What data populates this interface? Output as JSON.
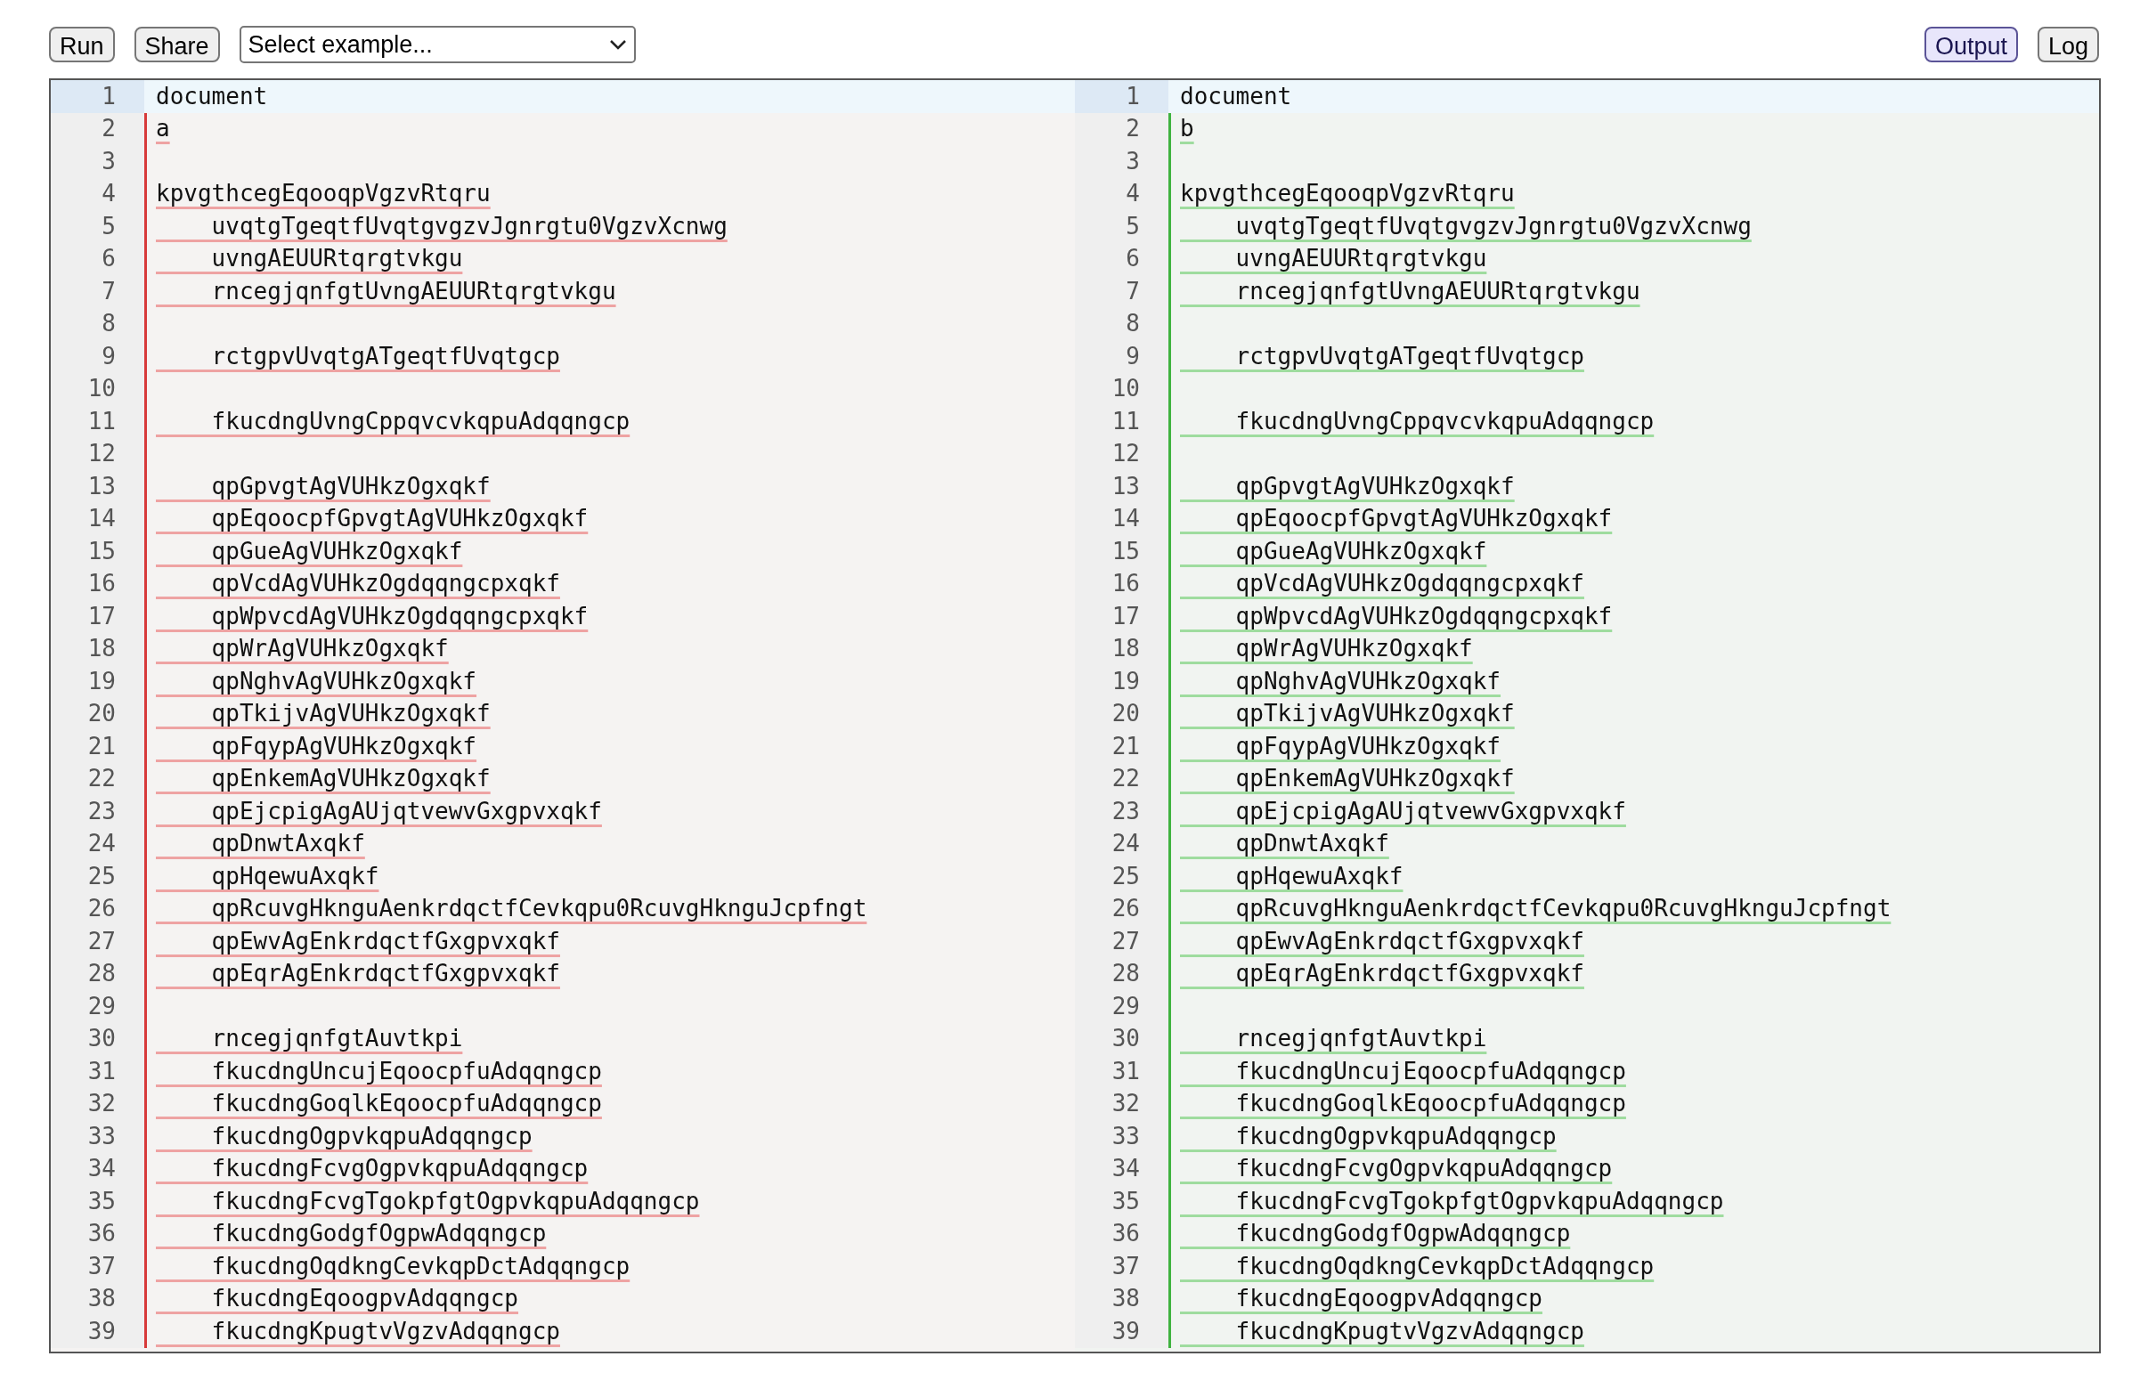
{
  "toolbar": {
    "left_buttons": [
      "Run",
      "Share"
    ],
    "example_select": {
      "value": "Select example..."
    },
    "view_tabs": [
      {
        "label": "Output",
        "selected": true
      },
      {
        "label": "Log",
        "selected": false
      }
    ]
  },
  "panes": [
    {
      "kind": "deleted",
      "lines": [
        {
          "number": "1",
          "text": "document",
          "active": true,
          "changed": false
        },
        {
          "number": "2",
          "text": "a",
          "active": false,
          "changed": true
        },
        {
          "number": "3",
          "active": false,
          "changed": true
        },
        {
          "number": "4",
          "text": "kpvgthcegEqooqpVgzvRtqru",
          "active": false,
          "changed": true
        },
        {
          "number": "5",
          "text": "    uvqtgTgeqtfUvqtgvgzvJgnrgtu0VgzvXcnwg",
          "active": false,
          "changed": true
        },
        {
          "number": "6",
          "text": "    uvngAEUURtqrgtvkgu",
          "active": false,
          "changed": true
        },
        {
          "number": "7",
          "text": "    rncegjqnfgtUvngAEUURtqrgtvkgu",
          "active": false,
          "changed": true
        },
        {
          "number": "8",
          "active": false,
          "changed": true
        },
        {
          "number": "9",
          "text": "    rctgpvUvqtgATgeqtfUvqtgcp",
          "active": false,
          "changed": true
        },
        {
          "number": "10",
          "active": false,
          "changed": true
        },
        {
          "number": "11",
          "text": "    fkucdngUvngCppqvcvkqpuAdqqngcp",
          "active": false,
          "changed": true
        },
        {
          "number": "12",
          "active": false,
          "changed": true
        },
        {
          "number": "13",
          "text": "    qpGpvgtAgVUHkzOgxqkf",
          "active": false,
          "changed": true
        },
        {
          "number": "14",
          "text": "    qpEqoocpfGpvgtAgVUHkzOgxqkf",
          "active": false,
          "changed": true
        },
        {
          "number": "15",
          "text": "    qpGueAgVUHkzOgxqkf",
          "active": false,
          "changed": true
        },
        {
          "number": "16",
          "text": "    qpVcdAgVUHkzOgdqqngcpxqkf",
          "active": false,
          "changed": true
        },
        {
          "number": "17",
          "text": "    qpWpvcdAgVUHkzOgdqqngcpxqkf",
          "active": false,
          "changed": true
        },
        {
          "number": "18",
          "text": "    qpWrAgVUHkzOgxqkf",
          "active": false,
          "changed": true
        },
        {
          "number": "19",
          "text": "    qpNghvAgVUHkzOgxqkf",
          "active": false,
          "changed": true
        },
        {
          "number": "20",
          "text": "    qpTkijvAgVUHkzOgxqkf",
          "active": false,
          "changed": true
        },
        {
          "number": "21",
          "text": "    qpFqypAgVUHkzOgxqkf",
          "active": false,
          "changed": true
        },
        {
          "number": "22",
          "text": "    qpEnkemAgVUHkzOgxqkf",
          "active": false,
          "changed": true
        },
        {
          "number": "23",
          "text": "    qpEjcpigAgAUjqtvewvGxgpvxqkf",
          "active": false,
          "changed": true
        },
        {
          "number": "24",
          "text": "    qpDnwtAxqkf",
          "active": false,
          "changed": true
        },
        {
          "number": "25",
          "text": "    qpHqewuAxqkf",
          "active": false,
          "changed": true
        },
        {
          "number": "26",
          "text": "    qpRcuvgHknguAenkrdqctfCevkqpu0RcuvgHknguJcpfngt",
          "active": false,
          "changed": true
        },
        {
          "number": "27",
          "text": "    qpEwvAgEnkrdqctfGxgpvxqkf",
          "active": false,
          "changed": true
        },
        {
          "number": "28",
          "text": "    qpEqrAgEnkrdqctfGxgpvxqkf",
          "active": false,
          "changed": true
        },
        {
          "number": "29",
          "active": false,
          "changed": true
        },
        {
          "number": "30",
          "text": "    rncegjqnfgtAuvtkpi",
          "active": false,
          "changed": true
        },
        {
          "number": "31",
          "text": "    fkucdngUncujEqoocpfuAdqqngcp",
          "active": false,
          "changed": true
        },
        {
          "number": "32",
          "text": "    fkucdngGoqlkEqoocpfuAdqqngcp",
          "active": false,
          "changed": true
        },
        {
          "number": "33",
          "text": "    fkucdngOgpvkqpuAdqqngcp",
          "active": false,
          "changed": true
        },
        {
          "number": "34",
          "text": "    fkucdngFcvgOgpvkqpuAdqqngcp",
          "active": false,
          "changed": true
        },
        {
          "number": "35",
          "text": "    fkucdngFcvgTgokpfgtOgpvkqpuAdqqngcp",
          "active": false,
          "changed": true
        },
        {
          "number": "36",
          "text": "    fkucdngGodgfOgpwAdqqngcp",
          "active": false,
          "changed": true
        },
        {
          "number": "37",
          "text": "    fkucdngOqdkngCevkqpDctAdqqngcp",
          "active": false,
          "changed": true
        },
        {
          "number": "38",
          "text": "    fkucdngEqoogpvAdqqngcp",
          "active": false,
          "changed": true
        },
        {
          "number": "39",
          "text": "    fkucdngKpugtvVgzvAdqqngcp",
          "active": false,
          "changed": true
        }
      ]
    },
    {
      "kind": "inserted",
      "lines": [
        {
          "number": "1",
          "text": "document",
          "active": true,
          "changed": false
        },
        {
          "number": "2",
          "text": "b",
          "active": false,
          "changed": true
        },
        {
          "number": "3",
          "active": false,
          "changed": true
        },
        {
          "number": "4",
          "text": "kpvgthcegEqooqpVgzvRtqru",
          "active": false,
          "changed": true
        },
        {
          "number": "5",
          "text": "    uvqtgTgeqtfUvqtgvgzvJgnrgtu0VgzvXcnwg",
          "active": false,
          "changed": true
        },
        {
          "number": "6",
          "text": "    uvngAEUURtqrgtvkgu",
          "active": false,
          "changed": true
        },
        {
          "number": "7",
          "text": "    rncegjqnfgtUvngAEUURtqrgtvkgu",
          "active": false,
          "changed": true
        },
        {
          "number": "8",
          "active": false,
          "changed": true
        },
        {
          "number": "9",
          "text": "    rctgpvUvqtgATgeqtfUvqtgcp",
          "active": false,
          "changed": true
        },
        {
          "number": "10",
          "active": false,
          "changed": true
        },
        {
          "number": "11",
          "text": "    fkucdngUvngCppqvcvkqpuAdqqngcp",
          "active": false,
          "changed": true
        },
        {
          "number": "12",
          "active": false,
          "changed": true
        },
        {
          "number": "13",
          "text": "    qpGpvgtAgVUHkzOgxqkf",
          "active": false,
          "changed": true
        },
        {
          "number": "14",
          "text": "    qpEqoocpfGpvgtAgVUHkzOgxqkf",
          "active": false,
          "changed": true
        },
        {
          "number": "15",
          "text": "    qpGueAgVUHkzOgxqkf",
          "active": false,
          "changed": true
        },
        {
          "number": "16",
          "text": "    qpVcdAgVUHkzOgdqqngcpxqkf",
          "active": false,
          "changed": true
        },
        {
          "number": "17",
          "text": "    qpWpvcdAgVUHkzOgdqqngcpxqkf",
          "active": false,
          "changed": true
        },
        {
          "number": "18",
          "text": "    qpWrAgVUHkzOgxqkf",
          "active": false,
          "changed": true
        },
        {
          "number": "19",
          "text": "    qpNghvAgVUHkzOgxqkf",
          "active": false,
          "changed": true
        },
        {
          "number": "20",
          "text": "    qpTkijvAgVUHkzOgxqkf",
          "active": false,
          "changed": true
        },
        {
          "number": "21",
          "text": "    qpFqypAgVUHkzOgxqkf",
          "active": false,
          "changed": true
        },
        {
          "number": "22",
          "text": "    qpEnkemAgVUHkzOgxqkf",
          "active": false,
          "changed": true
        },
        {
          "number": "23",
          "text": "    qpEjcpigAgAUjqtvewvGxgpvxqkf",
          "active": false,
          "changed": true
        },
        {
          "number": "24",
          "text": "    qpDnwtAxqkf",
          "active": false,
          "changed": true
        },
        {
          "number": "25",
          "text": "    qpHqewuAxqkf",
          "active": false,
          "changed": true
        },
        {
          "number": "26",
          "text": "    qpRcuvgHknguAenkrdqctfCevkqpu0RcuvgHknguJcpfngt",
          "active": false,
          "changed": true
        },
        {
          "number": "27",
          "text": "    qpEwvAgEnkrdqctfGxgpvxqkf",
          "active": false,
          "changed": true
        },
        {
          "number": "28",
          "text": "    qpEqrAgEnkrdqctfGxgpvxqkf",
          "active": false,
          "changed": true
        },
        {
          "number": "29",
          "active": false,
          "changed": true
        },
        {
          "number": "30",
          "text": "    rncegjqnfgtAuvtkpi",
          "active": false,
          "changed": true
        },
        {
          "number": "31",
          "text": "    fkucdngUncujEqoocpfuAdqqngcp",
          "active": false,
          "changed": true
        },
        {
          "number": "32",
          "text": "    fkucdngGoqlkEqoocpfuAdqqngcp",
          "active": false,
          "changed": true
        },
        {
          "number": "33",
          "text": "    fkucdngOgpvkqpuAdqqngcp",
          "active": false,
          "changed": true
        },
        {
          "number": "34",
          "text": "    fkucdngFcvgOgpvkqpuAdqqngcp",
          "active": false,
          "changed": true
        },
        {
          "number": "35",
          "text": "    fkucdngFcvgTgokpfgtOgpvkqpuAdqqngcp",
          "active": false,
          "changed": true
        },
        {
          "number": "36",
          "text": "    fkucdngGodgfOgpwAdqqngcp",
          "active": false,
          "changed": true
        },
        {
          "number": "37",
          "text": "    fkucdngOqdkngCevkqpDctAdqqngcp",
          "active": false,
          "changed": true
        },
        {
          "number": "38",
          "text": "    fkucdngEqoogpvAdqqngcp",
          "active": false,
          "changed": true
        },
        {
          "number": "39",
          "text": "    fkucdngKpugtvVgzvAdqqngcp",
          "active": false,
          "changed": true
        }
      ]
    }
  ]
}
